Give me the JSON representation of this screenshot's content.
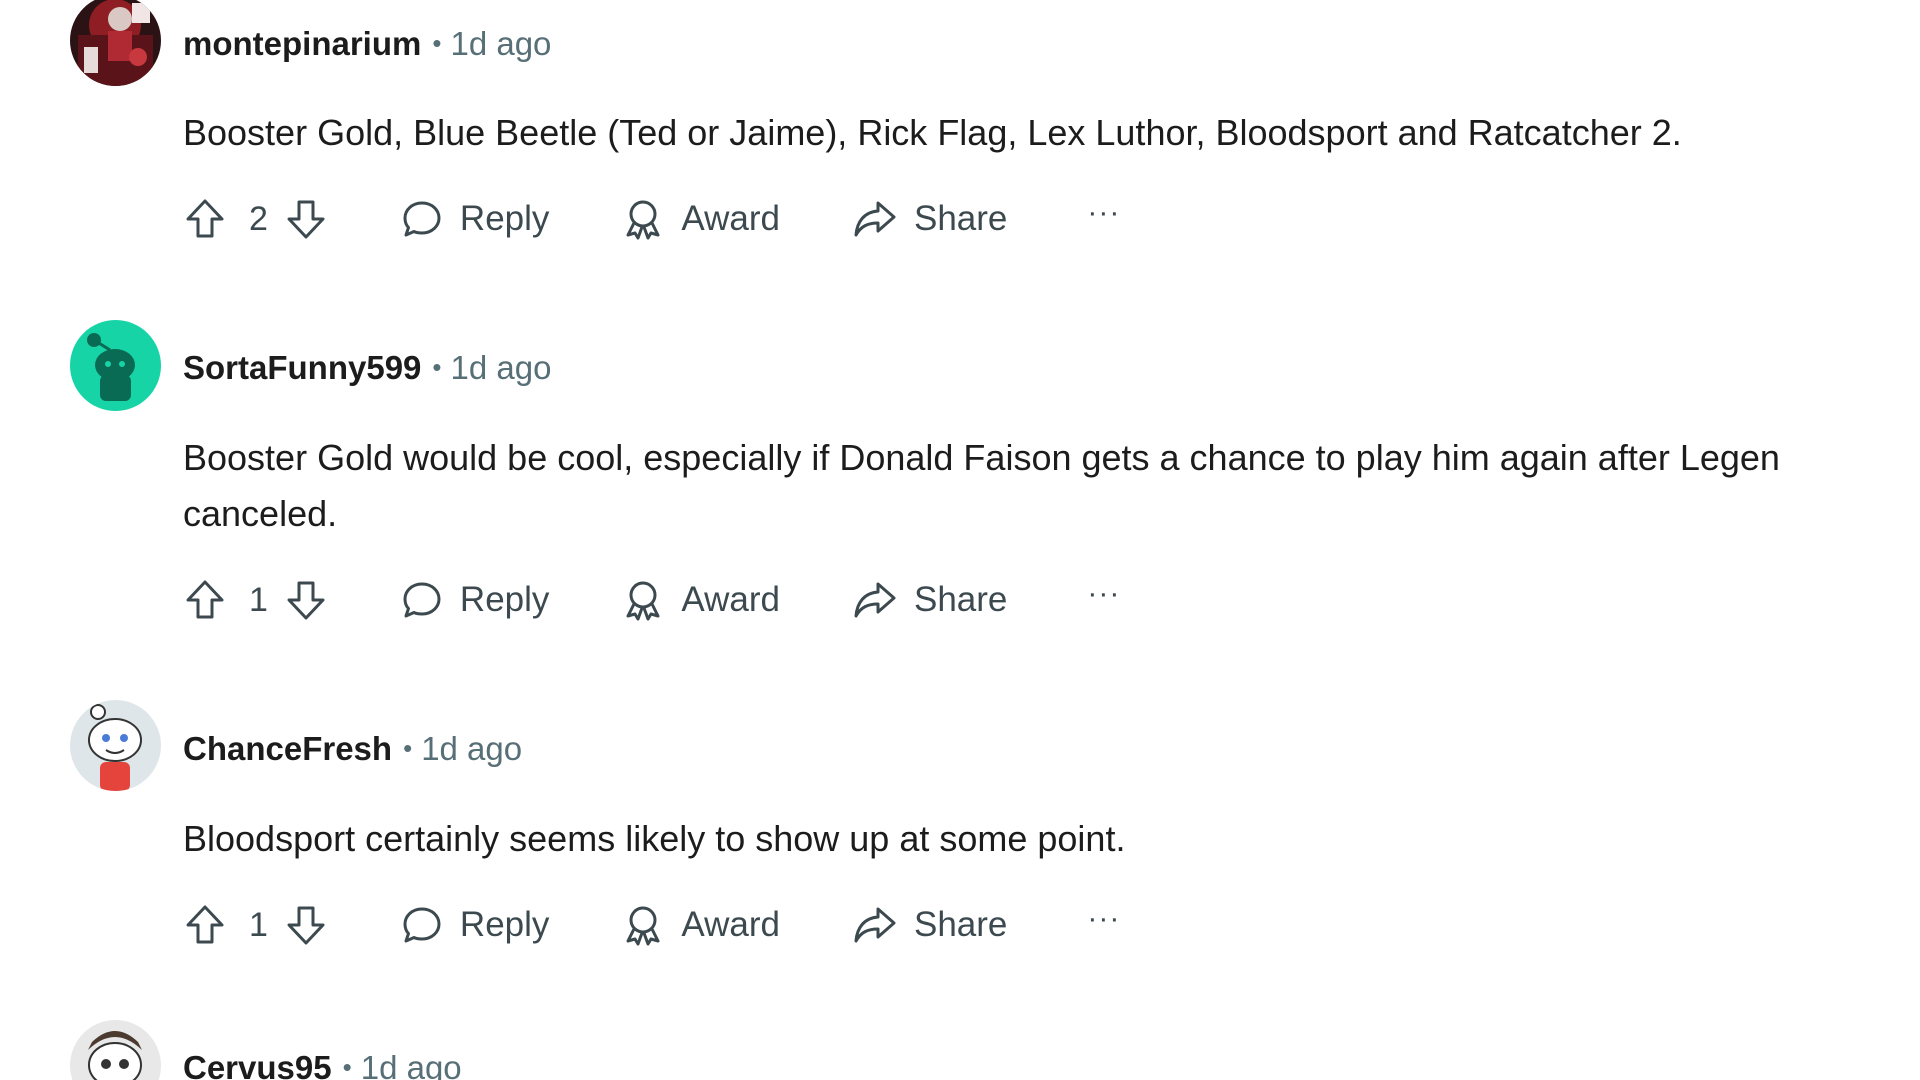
{
  "comments": [
    {
      "username": "montepinarium",
      "separator": "•",
      "time": "1d ago",
      "lines": [
        "Booster Gold, Blue Beetle (Ted or Jaime), Rick Flag, Lex Luthor, Bloodsport and Ratcatcher 2."
      ],
      "score": "2",
      "reply_label": "Reply",
      "award_label": "Award",
      "share_label": "Share",
      "more_label": "···",
      "avatar_color": "#7a1c22"
    },
    {
      "username": "SortaFunny599",
      "separator": "•",
      "time": "1d ago",
      "lines": [
        "Booster Gold would be cool, especially if Donald Faison gets a chance to play him again after Legen",
        "canceled."
      ],
      "score": "1",
      "reply_label": "Reply",
      "award_label": "Award",
      "share_label": "Share",
      "more_label": "···",
      "avatar_color": "#17d4a6"
    },
    {
      "username": "ChanceFresh",
      "separator": "•",
      "time": "1d ago",
      "lines": [
        "Bloodsport certainly seems likely to show up at some point."
      ],
      "score": "1",
      "reply_label": "Reply",
      "award_label": "Award",
      "share_label": "Share",
      "more_label": "···",
      "avatar_color": "#dfe6ea"
    },
    {
      "username": "Cervus95",
      "separator": "•",
      "time": "1d ago",
      "avatar_color": "#e8e8e8"
    }
  ]
}
